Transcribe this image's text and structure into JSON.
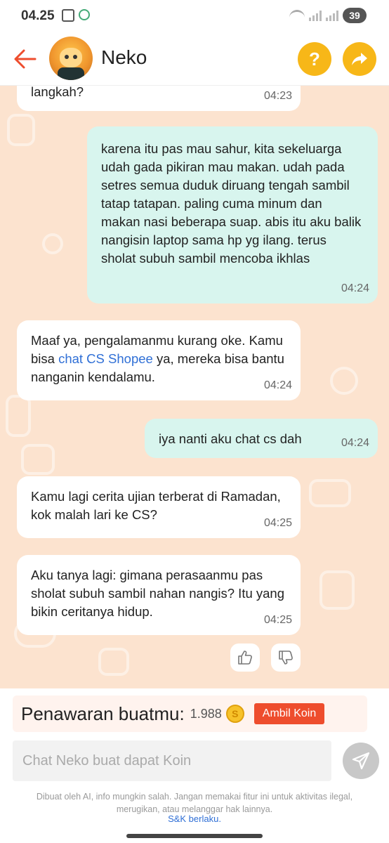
{
  "status_bar": {
    "time": "04.25",
    "battery": "39"
  },
  "header": {
    "title": "Neko",
    "help_label": "?"
  },
  "messages": [
    {
      "sender": "bot",
      "text": "langkah?",
      "time": "04:23"
    },
    {
      "sender": "user",
      "text": "karena itu pas mau sahur, kita sekeluarga udah gada pikiran mau makan. udah pada setres semua duduk diruang tengah sambil tatap tatapan. paling cuma minum dan makan nasi beberapa suap. abis itu aku balik nangisin laptop sama hp yg ilang. terus sholat subuh sambil mencoba ikhlas",
      "time": "04:24"
    },
    {
      "sender": "bot",
      "text_before": "Maaf ya, pengalamanmu kurang oke. Kamu bisa ",
      "link": "chat CS Shopee",
      "text_after": " ya, mereka bisa bantu nanganin kendalamu.",
      "time": "04:24"
    },
    {
      "sender": "user",
      "text": "iya nanti aku chat cs dah",
      "time": "04:24"
    },
    {
      "sender": "bot",
      "text": "Kamu lagi cerita ujian terberat di Ramadan, kok malah lari ke CS?",
      "time": "04:25"
    },
    {
      "sender": "bot",
      "text": "Aku tanya lagi: gimana perasaanmu pas sholat subuh sambil nahan nangis? Itu yang bikin ceritanya hidup.",
      "time": "04:25"
    }
  ],
  "offer": {
    "label": "Penawaran buatmu:",
    "count": "1.988",
    "coin_symbol": "S",
    "button": "Ambil Koin"
  },
  "composer": {
    "placeholder": "Chat Neko buat dapat Koin"
  },
  "footer": {
    "disclaimer": "Dibuat oleh AI, info mungkin salah. Jangan memakai fitur ini untuk aktivitas ilegal, merugikan, atau melanggar hak lainnya.",
    "terms": "S&K berlaku."
  },
  "colors": {
    "accent": "#ee4d2d",
    "header_button": "#f7b718",
    "chat_bg": "#fce3cf",
    "user_bubble": "#d8f5ee",
    "link": "#2f6fd6"
  }
}
